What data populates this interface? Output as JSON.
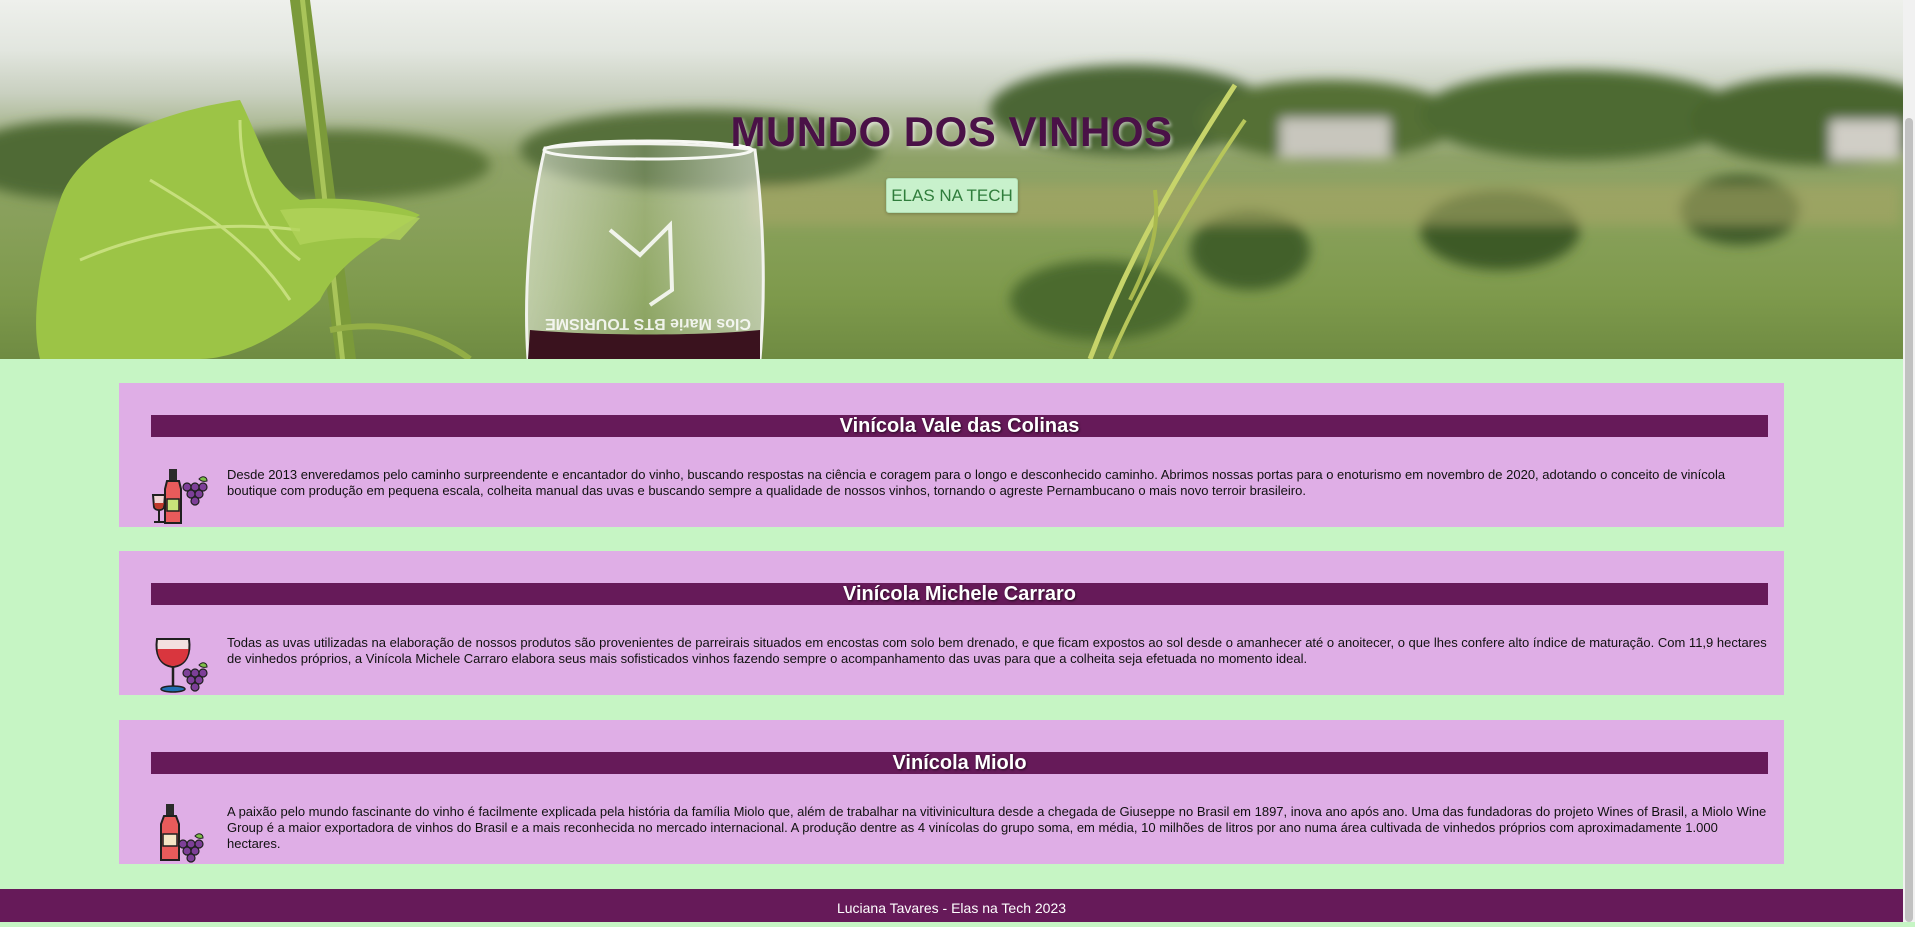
{
  "hero": {
    "title": "MUNDO DOS VINHOS",
    "button_label": "ELAS NA TECH",
    "glass_logo_text": "Clos Marie BTS TOURISME"
  },
  "cards": [
    {
      "title": "Vinícola Vale das Colinas",
      "icon": "wine-bottle-glass-grapes-icon",
      "text": "Desde 2013 enveredamos pelo caminho surpreendente e encantador do vinho, buscando respostas na ciência e coragem para o longo e desconhecido caminho. Abrimos nossas portas para o enoturismo em novembro de 2020, adotando o conceito de vinícola boutique com produção em pequena escala, colheita manual das uvas e buscando sempre a qualidade de nossos vinhos, tornando o agreste Pernambucano o mais novo terroir brasileiro."
    },
    {
      "title": "Vinícola Michele Carraro",
      "icon": "wine-glass-grapes-icon",
      "text": "Todas as uvas utilizadas na elaboração de nossos produtos são provenientes de parreirais situados em encostas com solo bem drenado, e que ficam expostos ao sol desde o amanhecer até o anoitecer, o que lhes confere alto índice de maturação. Com 11,9 hectares de vinhedos próprios, a Vinícola Michele Carraro elabora seus mais sofisticados vinhos fazendo sempre o acompanhamento das uvas para que a colheita seja efetuada no momento ideal."
    },
    {
      "title": "Vinícola Miolo",
      "icon": "wine-bottle-grapes-icon",
      "text": "A paixão pelo mundo fascinante do vinho é facilmente explicada pela história da família Miolo que, além de trabalhar na vitivinicultura desde a chegada de Giuseppe no Brasil em 1897, inova ano após ano. Uma das fundadoras do projeto Wines of Brasil, a Miolo Wine Group é a maior exportadora de vinhos do Brasil e a mais reconhecida no mercado internacional. A produção dentre as 4 vinícolas do grupo soma, em média, 10 milhões de litros por ano numa área cultivada de vinhedos próprios com aproximadamente 1.000 hectares."
    }
  ],
  "footer": {
    "text": "Luciana Tavares - Elas na Tech 2023"
  },
  "colors": {
    "page_background": "#c6f5c4",
    "card_background": "#dfaee6",
    "title_bar": "#661a59",
    "hero_title": "#4a1147",
    "button_background": "#c8f1cc",
    "button_text": "#2f7d3b"
  }
}
